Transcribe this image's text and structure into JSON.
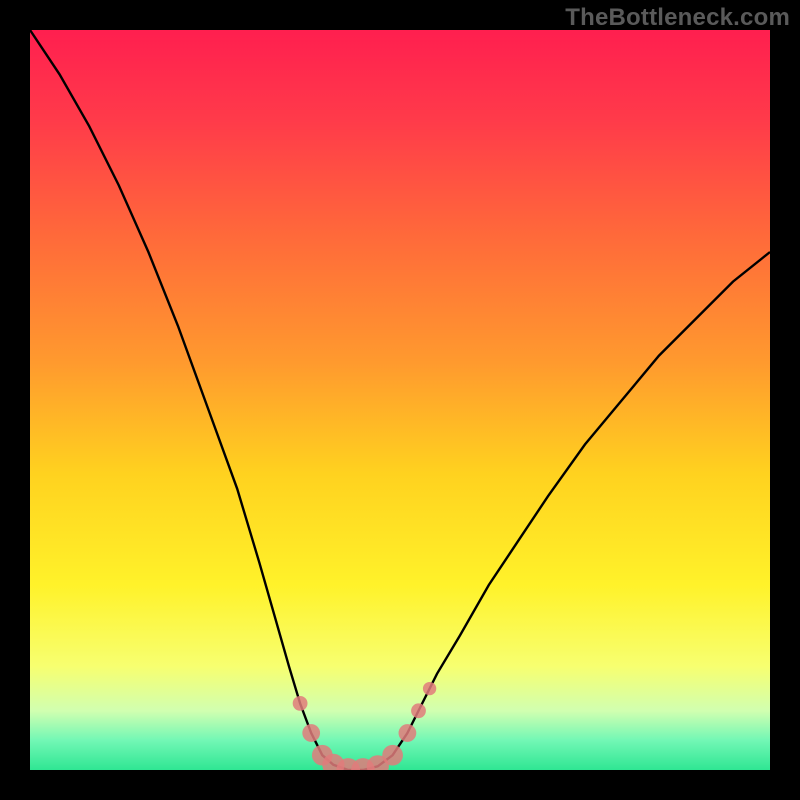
{
  "watermark_text": "TheBottleneck.com",
  "chart_data": {
    "type": "line",
    "title": "",
    "xlabel": "",
    "ylabel": "",
    "x_range": [
      0,
      100
    ],
    "y_range": [
      0,
      100
    ],
    "grid": false,
    "legend": false,
    "series": [
      {
        "name": "curve",
        "color": "#000000",
        "points": [
          {
            "x": 0,
            "y": 100
          },
          {
            "x": 4,
            "y": 94
          },
          {
            "x": 8,
            "y": 87
          },
          {
            "x": 12,
            "y": 79
          },
          {
            "x": 16,
            "y": 70
          },
          {
            "x": 20,
            "y": 60
          },
          {
            "x": 24,
            "y": 49
          },
          {
            "x": 28,
            "y": 38
          },
          {
            "x": 31,
            "y": 28
          },
          {
            "x": 33,
            "y": 21
          },
          {
            "x": 35,
            "y": 14
          },
          {
            "x": 36.5,
            "y": 9
          },
          {
            "x": 38,
            "y": 5
          },
          {
            "x": 39.5,
            "y": 2
          },
          {
            "x": 41,
            "y": 0.7
          },
          {
            "x": 43,
            "y": 0
          },
          {
            "x": 45,
            "y": 0
          },
          {
            "x": 47,
            "y": 0.5
          },
          {
            "x": 49,
            "y": 2
          },
          {
            "x": 51,
            "y": 5
          },
          {
            "x": 53,
            "y": 9
          },
          {
            "x": 55,
            "y": 13
          },
          {
            "x": 58,
            "y": 18
          },
          {
            "x": 62,
            "y": 25
          },
          {
            "x": 66,
            "y": 31
          },
          {
            "x": 70,
            "y": 37
          },
          {
            "x": 75,
            "y": 44
          },
          {
            "x": 80,
            "y": 50
          },
          {
            "x": 85,
            "y": 56
          },
          {
            "x": 90,
            "y": 61
          },
          {
            "x": 95,
            "y": 66
          },
          {
            "x": 100,
            "y": 70
          }
        ]
      },
      {
        "name": "marker-trail",
        "type": "scatter",
        "color": "#e07b7b",
        "points": [
          {
            "x": 36.5,
            "y": 9,
            "r": 1.0
          },
          {
            "x": 38,
            "y": 5,
            "r": 1.2
          },
          {
            "x": 39.5,
            "y": 2,
            "r": 1.4
          },
          {
            "x": 41,
            "y": 0.7,
            "r": 1.5
          },
          {
            "x": 43,
            "y": 0,
            "r": 1.6
          },
          {
            "x": 45,
            "y": 0,
            "r": 1.6
          },
          {
            "x": 47,
            "y": 0.5,
            "r": 1.5
          },
          {
            "x": 49,
            "y": 2,
            "r": 1.4
          },
          {
            "x": 51,
            "y": 5,
            "r": 1.2
          },
          {
            "x": 52.5,
            "y": 8,
            "r": 1.0
          },
          {
            "x": 54,
            "y": 11,
            "r": 0.9
          }
        ]
      }
    ],
    "background_gradient": {
      "type": "vertical",
      "stops": [
        {
          "offset": 0.0,
          "color": "#ff1f4f"
        },
        {
          "offset": 0.12,
          "color": "#ff3a4a"
        },
        {
          "offset": 0.28,
          "color": "#ff6a3a"
        },
        {
          "offset": 0.45,
          "color": "#ff9a2e"
        },
        {
          "offset": 0.6,
          "color": "#ffd21f"
        },
        {
          "offset": 0.75,
          "color": "#fff22a"
        },
        {
          "offset": 0.86,
          "color": "#f7ff70"
        },
        {
          "offset": 0.92,
          "color": "#d1ffb0"
        },
        {
          "offset": 0.96,
          "color": "#72f7b5"
        },
        {
          "offset": 1.0,
          "color": "#2fe693"
        }
      ]
    }
  }
}
